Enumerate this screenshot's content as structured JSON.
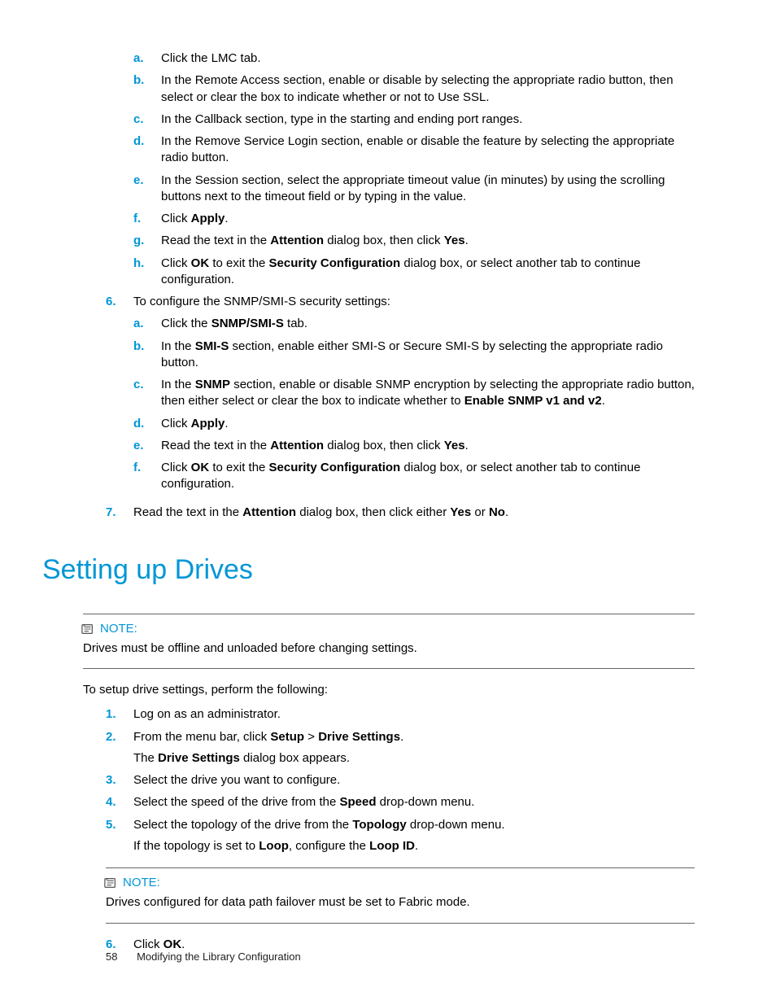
{
  "top_sub": {
    "a": "Click the LMC tab.",
    "b": "In the Remote Access section, enable or disable by selecting the appropriate radio button, then select or clear the box to indicate whether or not to Use SSL.",
    "c": "In the Callback section, type in the starting and ending port ranges.",
    "d": "In the Remove Service Login section, enable or disable the feature by selecting the appropriate radio button.",
    "e": "In the Session section, select the appropriate timeout value (in minutes) by using the scrolling buttons next to the timeout field or by typing in the value.",
    "f_pre": "Click ",
    "f_b": "Apply",
    "f_post": ".",
    "g_pre": "Read the text in the ",
    "g_b1": "Attention",
    "g_mid": " dialog box, then click ",
    "g_b2": "Yes",
    "g_post": ".",
    "h_pre": "Click ",
    "h_b1": "OK",
    "h_mid": " to exit the ",
    "h_b2": "Security Configuration",
    "h_post": " dialog box, or select another tab to continue configuration."
  },
  "step6": {
    "intro": "To configure the SNMP/SMI-S security settings:",
    "a_pre": "Click the ",
    "a_b": "SNMP/SMI-S",
    "a_post": " tab.",
    "b_pre": "In the ",
    "b_b": "SMI-S",
    "b_post": " section, enable either SMI-S or Secure SMI-S by selecting the appropriate radio button.",
    "c_pre": "In the ",
    "c_b1": "SNMP",
    "c_mid": " section, enable or disable SNMP encryption by selecting the appropriate radio button, then either select or clear the box to indicate whether to ",
    "c_b2": "Enable SNMP v1 and v2",
    "c_post": ".",
    "d_pre": "Click ",
    "d_b": "Apply",
    "d_post": ".",
    "e_pre": "Read the text in the ",
    "e_b1": "Attention",
    "e_mid": " dialog box, then click ",
    "e_b2": "Yes",
    "e_post": ".",
    "f_pre": "Click ",
    "f_b1": "OK",
    "f_mid": " to exit the ",
    "f_b2": "Security Configuration",
    "f_post": " dialog box, or select another tab to continue configuration."
  },
  "step7": {
    "pre": "Read the text in the ",
    "b1": "Attention",
    "mid": " dialog box, then click either ",
    "b2": "Yes",
    "mid2": " or ",
    "b3": "No",
    "post": "."
  },
  "heading": "Setting up Drives",
  "note1": {
    "label": "NOTE:",
    "text": "Drives must be offline and unloaded before changing settings."
  },
  "intro2": "To setup drive settings, perform the following:",
  "drive": {
    "s1": "Log on as an administrator.",
    "s2_pre": "From the menu bar, click ",
    "s2_b1": "Setup",
    "s2_mid": " > ",
    "s2_b2": "Drive Settings",
    "s2_post": ".",
    "s2b_pre": "The ",
    "s2b_b": "Drive Settings",
    "s2b_post": " dialog box appears.",
    "s3": "Select the drive you want to configure.",
    "s4_pre": "Select the speed of the drive from the ",
    "s4_b": "Speed",
    "s4_post": " drop-down menu.",
    "s5_pre": "Select the topology of the drive from the ",
    "s5_b": "Topology",
    "s5_post": " drop-down menu.",
    "s5b_pre": "If the topology is set to ",
    "s5b_b1": "Loop",
    "s5b_mid": ", configure the ",
    "s5b_b2": "Loop ID",
    "s5b_post": ".",
    "s6_pre": "Click ",
    "s6_b": "OK",
    "s6_post": "."
  },
  "note2": {
    "label": "NOTE:",
    "text": "Drives configured for data path failover must be set to Fabric mode."
  },
  "footer": {
    "page": "58",
    "title": "Modifying the Library Configuration"
  },
  "markers": {
    "a": "a.",
    "b": "b.",
    "c": "c.",
    "d": "d.",
    "e": "e.",
    "f": "f.",
    "g": "g.",
    "h": "h.",
    "n1": "1.",
    "n2": "2.",
    "n3": "3.",
    "n4": "4.",
    "n5": "5.",
    "n6": "6.",
    "n7": "7."
  }
}
